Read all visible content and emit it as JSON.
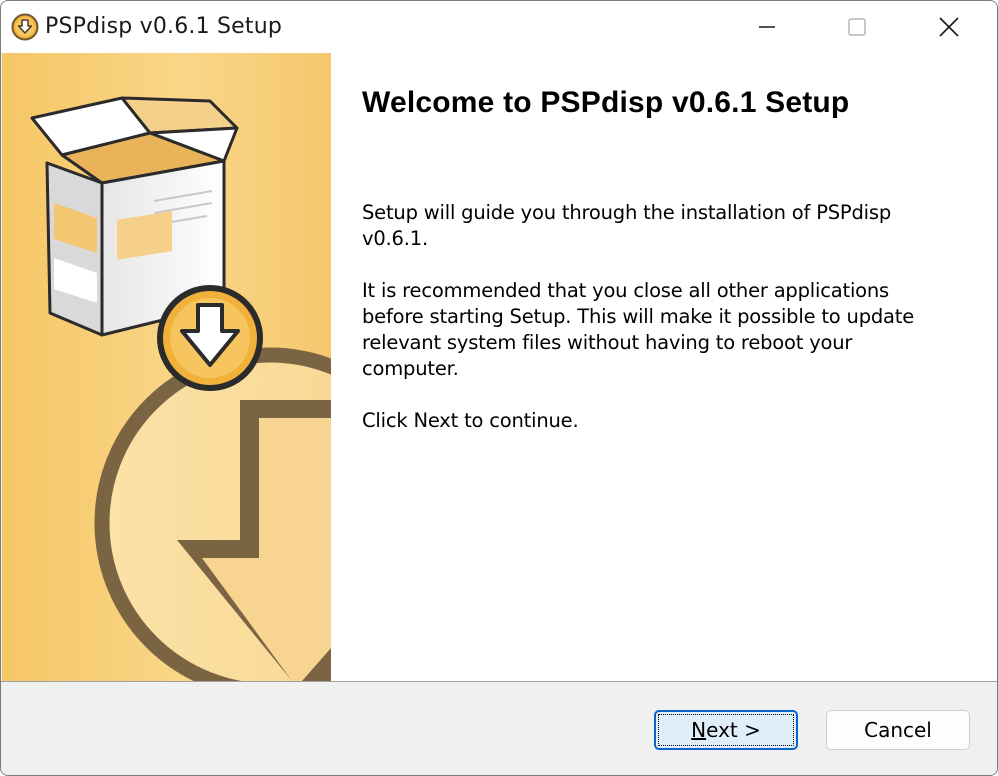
{
  "window": {
    "title": "PSPdisp v0.6.1 Setup"
  },
  "main": {
    "heading": "Welcome to PSPdisp v0.6.1 Setup",
    "paragraph1": "Setup will guide you through the installation of PSPdisp v0.6.1.",
    "paragraph2": "It is recommended that you close all other applications before starting Setup. This will make it possible to update relevant system files without having to reboot your computer.",
    "paragraph3": "Click Next to continue."
  },
  "buttons": {
    "next_mnemonic": "N",
    "next_rest": "ext >",
    "cancel": "Cancel"
  },
  "colors": {
    "banner": "#f8cf7c",
    "accent_dark": "#7a6443",
    "focus_blue": "#0a64c8"
  },
  "icons": {
    "app": "installer-disc-icon",
    "banner": "installer-box-download-graphic"
  }
}
